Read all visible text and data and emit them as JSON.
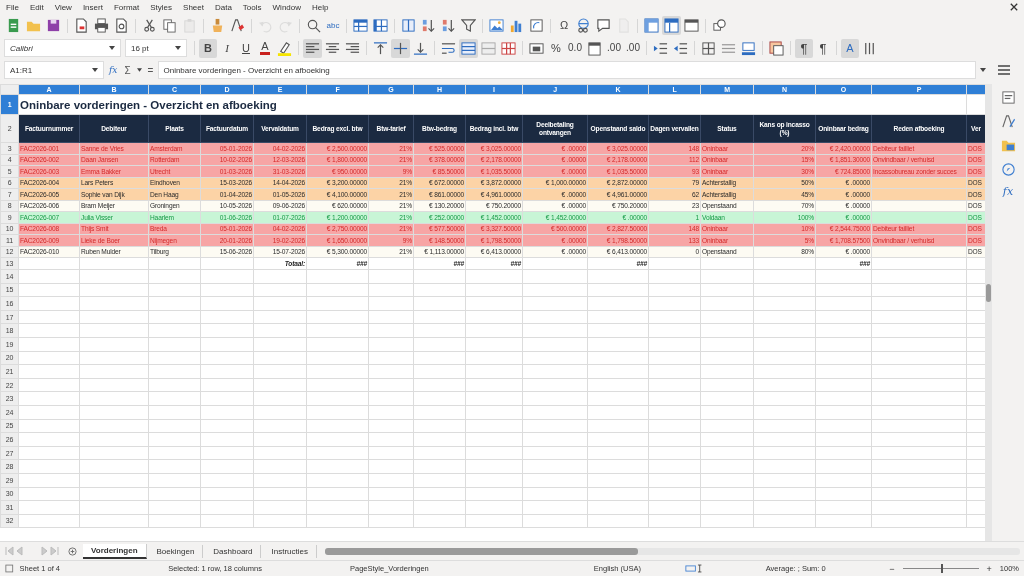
{
  "menu": [
    "File",
    "Edit",
    "View",
    "Insert",
    "Format",
    "Styles",
    "Sheet",
    "Data",
    "Tools",
    "Window",
    "Help"
  ],
  "standard_toolbar": [
    {
      "kind": "new",
      "selected": false,
      "disabled": false
    },
    {
      "kind": "open",
      "selected": false,
      "disabled": false
    },
    {
      "kind": "save",
      "selected": false,
      "disabled": false
    },
    {
      "kind": "separator"
    },
    {
      "kind": "pdf",
      "selected": false,
      "disabled": false
    },
    {
      "kind": "print",
      "selected": false,
      "disabled": false
    },
    {
      "kind": "preview",
      "selected": false,
      "disabled": false
    },
    {
      "kind": "separator"
    },
    {
      "kind": "cut",
      "selected": false,
      "disabled": false
    },
    {
      "kind": "copy",
      "selected": false,
      "disabled": false
    },
    {
      "kind": "paste",
      "selected": false,
      "disabled": true
    },
    {
      "kind": "separator"
    },
    {
      "kind": "clone",
      "selected": false,
      "disabled": false
    },
    {
      "kind": "clear",
      "selected": false,
      "disabled": false
    },
    {
      "kind": "separator"
    },
    {
      "kind": "undo",
      "selected": false,
      "disabled": true
    },
    {
      "kind": "redo",
      "selected": false,
      "disabled": true
    },
    {
      "kind": "separator"
    },
    {
      "kind": "find",
      "selected": false,
      "disabled": false
    },
    {
      "kind": "spelling",
      "label": "abc",
      "selected": false,
      "disabled": false
    },
    {
      "kind": "separator"
    },
    {
      "kind": "rows",
      "selected": false,
      "disabled": false
    },
    {
      "kind": "columns",
      "selected": false,
      "disabled": false
    },
    {
      "kind": "separator"
    },
    {
      "kind": "sort",
      "selected": false,
      "disabled": false
    },
    {
      "kind": "sortasc",
      "selected": false,
      "disabled": false
    },
    {
      "kind": "sortdesc",
      "selected": false,
      "disabled": false
    },
    {
      "kind": "filter",
      "selected": false,
      "disabled": false
    },
    {
      "kind": "separator"
    },
    {
      "kind": "image",
      "selected": false,
      "disabled": false
    },
    {
      "kind": "chart",
      "selected": false,
      "disabled": false
    },
    {
      "kind": "pivot",
      "selected": false,
      "disabled": false
    },
    {
      "kind": "separator"
    },
    {
      "kind": "special",
      "label": "Ω",
      "selected": false,
      "disabled": false
    },
    {
      "kind": "hyperlink",
      "selected": false,
      "disabled": false
    },
    {
      "kind": "comment",
      "selected": false,
      "disabled": false
    },
    {
      "kind": "headers",
      "selected": false,
      "disabled": true
    },
    {
      "kind": "separator"
    },
    {
      "kind": "freeze",
      "selected": false,
      "disabled": false
    },
    {
      "kind": "split",
      "selected": true,
      "disabled": false
    },
    {
      "kind": "window",
      "selected": false,
      "disabled": false
    },
    {
      "kind": "separator"
    },
    {
      "kind": "shapes",
      "selected": false,
      "disabled": false
    }
  ],
  "formatting_toolbar": [
    {
      "kind": "font",
      "value": "Calibri"
    },
    {
      "kind": "size",
      "value": "16 pt"
    },
    {
      "kind": "separator"
    },
    {
      "kind": "bold",
      "label": "B",
      "selected": true
    },
    {
      "kind": "italic",
      "label": "I",
      "selected": false
    },
    {
      "kind": "underline",
      "label": "U",
      "selected": false
    },
    {
      "kind": "fontcolor",
      "label": "A",
      "selected": false
    },
    {
      "kind": "highlight",
      "selected": false
    },
    {
      "kind": "separator"
    },
    {
      "kind": "alignleft",
      "selected": true
    },
    {
      "kind": "aligncenter",
      "selected": false
    },
    {
      "kind": "alignright",
      "selected": false
    },
    {
      "kind": "separator"
    },
    {
      "kind": "top",
      "selected": false
    },
    {
      "kind": "middle",
      "selected": true
    },
    {
      "kind": "bottom",
      "selected": false
    },
    {
      "kind": "separator"
    },
    {
      "kind": "wrap",
      "selected": false
    },
    {
      "kind": "merge",
      "selected": true
    },
    {
      "kind": "mergecells",
      "selected": false
    },
    {
      "kind": "unmerge",
      "selected": false
    },
    {
      "kind": "separator"
    },
    {
      "kind": "numberformat",
      "selected": false
    },
    {
      "kind": "percent",
      "label": "%",
      "selected": false
    },
    {
      "kind": "number",
      "label": "0.0",
      "selected": false
    },
    {
      "kind": "date",
      "selected": false
    },
    {
      "kind": "adddecimal",
      "label": ".00",
      "selected": false
    },
    {
      "kind": "deldecimal",
      "label": ".00",
      "selected": false
    },
    {
      "kind": "separator"
    },
    {
      "kind": "indent",
      "selected": false
    },
    {
      "kind": "outdent",
      "selected": false
    },
    {
      "kind": "separator"
    },
    {
      "kind": "borders",
      "selected": false
    },
    {
      "kind": "borderstyle",
      "selected": false
    },
    {
      "kind": "bordercolor",
      "selected": false
    },
    {
      "kind": "separator"
    },
    {
      "kind": "conditional",
      "selected": false
    },
    {
      "kind": "separator"
    },
    {
      "kind": "ltr",
      "label": "¶",
      "selected": true
    },
    {
      "kind": "rtl",
      "label": "¶",
      "selected": false
    },
    {
      "kind": "separator"
    },
    {
      "kind": "stacked",
      "label": "A",
      "selected": true
    },
    {
      "kind": "vertical",
      "selected": false
    }
  ],
  "formula_bar": {
    "cell_ref": "A1:R1",
    "wizard": "fx",
    "sum": "Σ",
    "equals": "=",
    "content": "Oninbare vorderingen - Overzicht en afboeking"
  },
  "columns": [
    {
      "letter": "A",
      "selected": true
    },
    {
      "letter": "B",
      "selected": true
    },
    {
      "letter": "C",
      "selected": true
    },
    {
      "letter": "D",
      "selected": true
    },
    {
      "letter": "E",
      "selected": true
    },
    {
      "letter": "F",
      "selected": true
    },
    {
      "letter": "G",
      "selected": true
    },
    {
      "letter": "H",
      "selected": true
    },
    {
      "letter": "I",
      "selected": true
    },
    {
      "letter": "J",
      "selected": true
    },
    {
      "letter": "K",
      "selected": true
    },
    {
      "letter": "L",
      "selected": true
    },
    {
      "letter": "M",
      "selected": true
    },
    {
      "letter": "N",
      "selected": true
    },
    {
      "letter": "O",
      "selected": true
    },
    {
      "letter": "P",
      "selected": true
    },
    {
      "selected": true
    }
  ],
  "title_row": {
    "number": "1",
    "selected": true,
    "title": "Oninbare vorderingen - Overzicht en afboeking"
  },
  "header_row": {
    "number": "2",
    "selected": false,
    "headers": [
      "Factuurnummer",
      "Debiteur",
      "Plaats",
      "Factuurdatum",
      "Vervaldatum",
      "Bedrag excl. btw",
      "Btw-tarief",
      "Btw-bedrag",
      "Bedrag incl. btw",
      "Deelbetaling ontvangen",
      "Openstaand saldo",
      "Dagen vervallen",
      "Status",
      "Kans op incasso (%)",
      "Oninbaar bedrag",
      "Reden afboeking",
      "Ver"
    ]
  },
  "rows": [
    {
      "number": "3",
      "kind": "oninbaar",
      "selected": false,
      "cells": [
        "FAC2026-001",
        "Sanne de Vries",
        "Amsterdam",
        "05-01-2026",
        "04-02-2026",
        "€ 2,500.00000",
        "21%",
        "€ 525.00000",
        "€ 3,025.00000",
        "€ .00000",
        "€ 3,025.00000",
        "148",
        "Oninbaar",
        "20%",
        "€ 2,420.00000",
        "Debiteur failliet",
        "DOS"
      ]
    },
    {
      "number": "4",
      "kind": "oninbaar",
      "selected": false,
      "cells": [
        "FAC2026-002",
        "Daan Jansen",
        "Rotterdam",
        "10-02-2026",
        "12-03-2026",
        "€ 1,800.00000",
        "21%",
        "€ 378.00000",
        "€ 2,178.00000",
        "€ .00000",
        "€ 2,178.00000",
        "112",
        "Oninbaar",
        "15%",
        "€ 1,851.30000",
        "Onvindbaar / verhuisd",
        "DOS"
      ]
    },
    {
      "number": "5",
      "kind": "oninbaar",
      "selected": false,
      "cells": [
        "FAC2026-003",
        "Emma Bakker",
        "Utrecht",
        "01-03-2026",
        "31-03-2026",
        "€ 950.00000",
        "9%",
        "€ 85.50000",
        "€ 1,035.50000",
        "€ .00000",
        "€ 1,035.50000",
        "93",
        "Oninbaar",
        "30%",
        "€ 724.85000",
        "Incassobureau zonder succes",
        "DOS"
      ]
    },
    {
      "number": "6",
      "kind": "achterstallig",
      "selected": false,
      "cells": [
        "FAC2026-004",
        "Lars Peters",
        "Eindhoven",
        "15-03-2026",
        "14-04-2026",
        "€ 3,200.00000",
        "21%",
        "€ 672.00000",
        "€ 3,872.00000",
        "€ 1,000.00000",
        "€ 2,872.00000",
        "79",
        "Achterstallig",
        "50%",
        "€ .00000",
        "",
        "DOS"
      ]
    },
    {
      "number": "7",
      "kind": "achterstallig",
      "selected": false,
      "cells": [
        "FAC2026-005",
        "Sophie van Dijk",
        "Den Haag",
        "01-04-2026",
        "01-05-2026",
        "€ 4,100.00000",
        "21%",
        "€ 861.00000",
        "€ 4,961.00000",
        "€ .00000",
        "€ 4,961.00000",
        "62",
        "Achterstallig",
        "45%",
        "€ .00000",
        "",
        "DOS"
      ]
    },
    {
      "number": "8",
      "kind": "openstaand",
      "selected": false,
      "cells": [
        "FAC2026-006",
        "Bram Meijer",
        "Groningen",
        "10-05-2026",
        "09-06-2026",
        "€ 620.00000",
        "21%",
        "€ 130.20000",
        "€ 750.20000",
        "€ .00000",
        "€ 750.20000",
        "23",
        "Openstaand",
        "70%",
        "€ .00000",
        "",
        "DOS"
      ]
    },
    {
      "number": "9",
      "kind": "voldaan",
      "selected": false,
      "cells": [
        "FAC2026-007",
        "Julia Visser",
        "Haarlem",
        "01-06-2026",
        "01-07-2026",
        "€ 1,200.00000",
        "21%",
        "€ 252.00000",
        "€ 1,452.00000",
        "€ 1,452.00000",
        "€ .00000",
        "1",
        "Voldaan",
        "100%",
        "€ .00000",
        "",
        "DOS"
      ]
    },
    {
      "number": "10",
      "kind": "oninbaar",
      "selected": false,
      "cells": [
        "FAC2026-008",
        "Thijs Smit",
        "Breda",
        "05-01-2026",
        "04-02-2026",
        "€ 2,750.00000",
        "21%",
        "€ 577.50000",
        "€ 3,327.50000",
        "€ 500.00000",
        "€ 2,827.50000",
        "148",
        "Oninbaar",
        "10%",
        "€ 2,544.75000",
        "Debiteur failliet",
        "DOS"
      ]
    },
    {
      "number": "11",
      "kind": "oninbaar",
      "selected": false,
      "cells": [
        "FAC2026-009",
        "Lieke de Boer",
        "Nijmegen",
        "20-01-2026",
        "19-02-2026",
        "€ 1,650.00000",
        "9%",
        "€ 148.50000",
        "€ 1,798.50000",
        "€ .00000",
        "€ 1,798.50000",
        "133",
        "Oninbaar",
        "5%",
        "€ 1,708.57500",
        "Onvindbaar / verhuisd",
        "DOS"
      ]
    },
    {
      "number": "12",
      "kind": "openstaand",
      "selected": false,
      "cells": [
        "FAC2026-010",
        "Ruben Mulder",
        "Tilburg",
        "15-06-2026",
        "15-07-2026",
        "€ 5,300.00000",
        "21%",
        "€ 1,113.00000",
        "€ 6,413.00000",
        "€ .00000",
        "€ 6,413.00000",
        "0",
        "Openstaand",
        "80%",
        "€ .00000",
        "",
        "DOS"
      ]
    },
    {
      "number": "13",
      "kind": "total",
      "selected": false,
      "cells": [
        "",
        "",
        "",
        "",
        "Totaal:",
        "###",
        "",
        "###",
        "###",
        "",
        "###",
        "",
        "",
        "",
        "###",
        "",
        ""
      ]
    }
  ],
  "empty_rows": [
    "14",
    "15",
    "16",
    "17",
    "18",
    "19",
    "20",
    "21",
    "22",
    "23",
    "24",
    "25",
    "26",
    "27",
    "28",
    "29",
    "30",
    "31",
    "32"
  ],
  "sheet_tabs": [
    {
      "label": "Vorderingen",
      "selected": true
    },
    {
      "label": "Boekingen",
      "selected": false
    },
    {
      "label": "Dashboard",
      "selected": false
    },
    {
      "label": "Instructies",
      "selected": false
    }
  ],
  "sidebar": [
    {
      "kind": "properties"
    },
    {
      "kind": "styles"
    },
    {
      "kind": "gallery"
    },
    {
      "kind": "navigator"
    },
    {
      "kind": "functions",
      "label": "fx"
    }
  ],
  "status_bar": {
    "sheet": "Sheet 1 of 4",
    "selection": "Selected: 1 row, 18 columns",
    "page_style": "PageStyle_Vorderingen",
    "language": "English (USA)",
    "summary": "Average: ; Sum: 0",
    "zoom_out": "−",
    "zoom_in": "+",
    "zoom": {
      "level": 0.5
    },
    "zoom_text": "100%"
  }
}
